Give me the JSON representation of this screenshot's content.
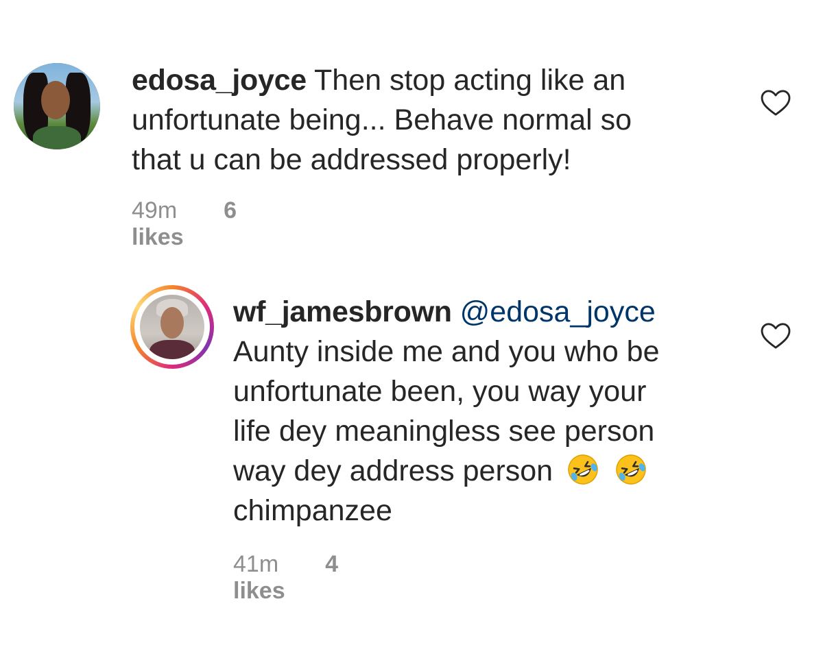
{
  "comments": [
    {
      "username": "edosa_joyce",
      "mention": "",
      "lines": [
        " Then stop acting like an",
        "unfortunate being... Behave normal so",
        "that u can be addressed properly!"
      ],
      "time": "49m",
      "likes": "6 likes"
    },
    {
      "username": "wf_jamesbrown",
      "mention": "@edosa_joyce",
      "lines": [
        "Aunty inside me and you who be",
        "unfortunate been, you way your",
        "life dey meaningless see person",
        "way dey address person",
        "chimpanzee"
      ],
      "time": "41m",
      "likes": "4 likes"
    }
  ],
  "icons": {
    "like": "heart-outline-icon",
    "emoji": "rolling-on-floor-laughing-emoji"
  },
  "colors": {
    "text": "#262626",
    "meta": "#8e8e8e",
    "mention": "#003569",
    "ring_start": "#f58529",
    "ring_end": "#dd2a7b"
  }
}
